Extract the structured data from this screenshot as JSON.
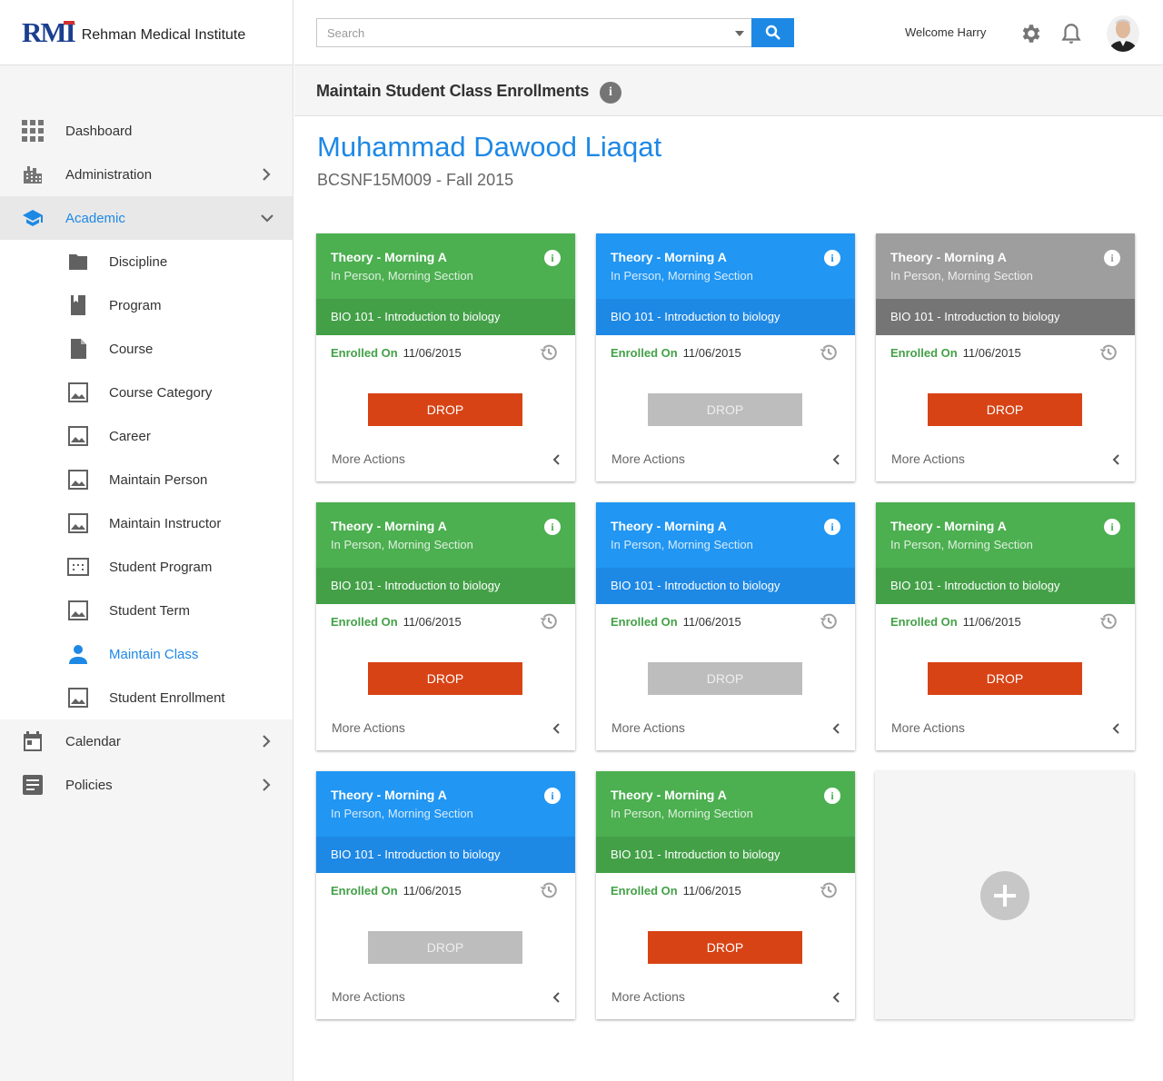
{
  "brand": {
    "logo": "RMI",
    "name": "Rehman Medical Institute"
  },
  "search": {
    "placeholder": "Search"
  },
  "user": {
    "welcome": "Welcome Harry"
  },
  "nav": {
    "top": [
      {
        "label": "Dashboard",
        "icon": "grid-icon"
      },
      {
        "label": "Administration",
        "icon": "building-icon"
      },
      {
        "label": "Academic",
        "icon": "graduation-cap-icon"
      }
    ],
    "academic_sub": [
      {
        "label": "Discipline",
        "icon": "folder-icon"
      },
      {
        "label": "Program",
        "icon": "bookmark-book-icon"
      },
      {
        "label": "Course",
        "icon": "document-icon"
      },
      {
        "label": "Course Category",
        "icon": "image-icon"
      },
      {
        "label": "Career",
        "icon": "image-icon"
      },
      {
        "label": "Maintain Person",
        "icon": "image-icon"
      },
      {
        "label": "Maintain Instructor",
        "icon": "image-icon"
      },
      {
        "label": "Student Program",
        "icon": "dialpad-icon"
      },
      {
        "label": "Student Term",
        "icon": "image-icon"
      },
      {
        "label": "Maintain Class",
        "icon": "person-icon"
      },
      {
        "label": "Student Enrollment",
        "icon": "image-icon"
      }
    ],
    "bottom": [
      {
        "label": "Calendar",
        "icon": "calendar-icon"
      },
      {
        "label": "Policies",
        "icon": "document-list-icon"
      }
    ]
  },
  "page": {
    "title": "Maintain Student Class Enrollments"
  },
  "student": {
    "name": "Muhammad Dawood Liaqat",
    "sub": "BCSNF15M009 - Fall 2015"
  },
  "cards": [
    {
      "color": "green",
      "title": "Theory - Morning A",
      "subtitle": "In Person, Morning Section",
      "course": "BIO 101 - Introduction to biology",
      "enrolled_label": "Enrolled On",
      "enrolled_date": "11/06/2015",
      "drop_label": "DROP",
      "drop_enabled": true,
      "more_label": "More Actions"
    },
    {
      "color": "blue",
      "title": "Theory - Morning A",
      "subtitle": "In Person, Morning Section",
      "course": "BIO 101 - Introduction to biology",
      "enrolled_label": "Enrolled On",
      "enrolled_date": "11/06/2015",
      "drop_label": "DROP",
      "drop_enabled": false,
      "more_label": "More Actions"
    },
    {
      "color": "grey",
      "title": "Theory - Morning A",
      "subtitle": "In Person, Morning Section",
      "course": "BIO 101 - Introduction to biology",
      "enrolled_label": "Enrolled On",
      "enrolled_date": "11/06/2015",
      "drop_label": "DROP",
      "drop_enabled": true,
      "more_label": "More Actions"
    },
    {
      "color": "green",
      "title": "Theory - Morning A",
      "subtitle": "In Person, Morning Section",
      "course": "BIO 101 - Introduction to biology",
      "enrolled_label": "Enrolled On",
      "enrolled_date": "11/06/2015",
      "drop_label": "DROP",
      "drop_enabled": true,
      "more_label": "More Actions"
    },
    {
      "color": "blue",
      "title": "Theory - Morning A",
      "subtitle": "In Person, Morning Section",
      "course": "BIO 101 - Introduction to biology",
      "enrolled_label": "Enrolled On",
      "enrolled_date": "11/06/2015",
      "drop_label": "DROP",
      "drop_enabled": false,
      "more_label": "More Actions"
    },
    {
      "color": "green",
      "title": "Theory - Morning A",
      "subtitle": "In Person, Morning Section",
      "course": "BIO 101 - Introduction to biology",
      "enrolled_label": "Enrolled On",
      "enrolled_date": "11/06/2015",
      "drop_label": "DROP",
      "drop_enabled": true,
      "more_label": "More Actions"
    },
    {
      "color": "blue",
      "title": "Theory - Morning A",
      "subtitle": "In Person, Morning Section",
      "course": "BIO 101 - Introduction to biology",
      "enrolled_label": "Enrolled On",
      "enrolled_date": "11/06/2015",
      "drop_label": "DROP",
      "drop_enabled": false,
      "more_label": "More Actions"
    },
    {
      "color": "green",
      "title": "Theory - Morning A",
      "subtitle": "In Person, Morning Section",
      "course": "BIO 101 - Introduction to biology",
      "enrolled_label": "Enrolled On",
      "enrolled_date": "11/06/2015",
      "drop_label": "DROP",
      "drop_enabled": true,
      "more_label": "More Actions"
    }
  ],
  "colors": {
    "accent": "#1e88e5",
    "green": "#4caf50",
    "blue": "#2196f3",
    "grey": "#9e9e9e",
    "drop": "#d84315",
    "disabled": "#bdbdbd"
  }
}
